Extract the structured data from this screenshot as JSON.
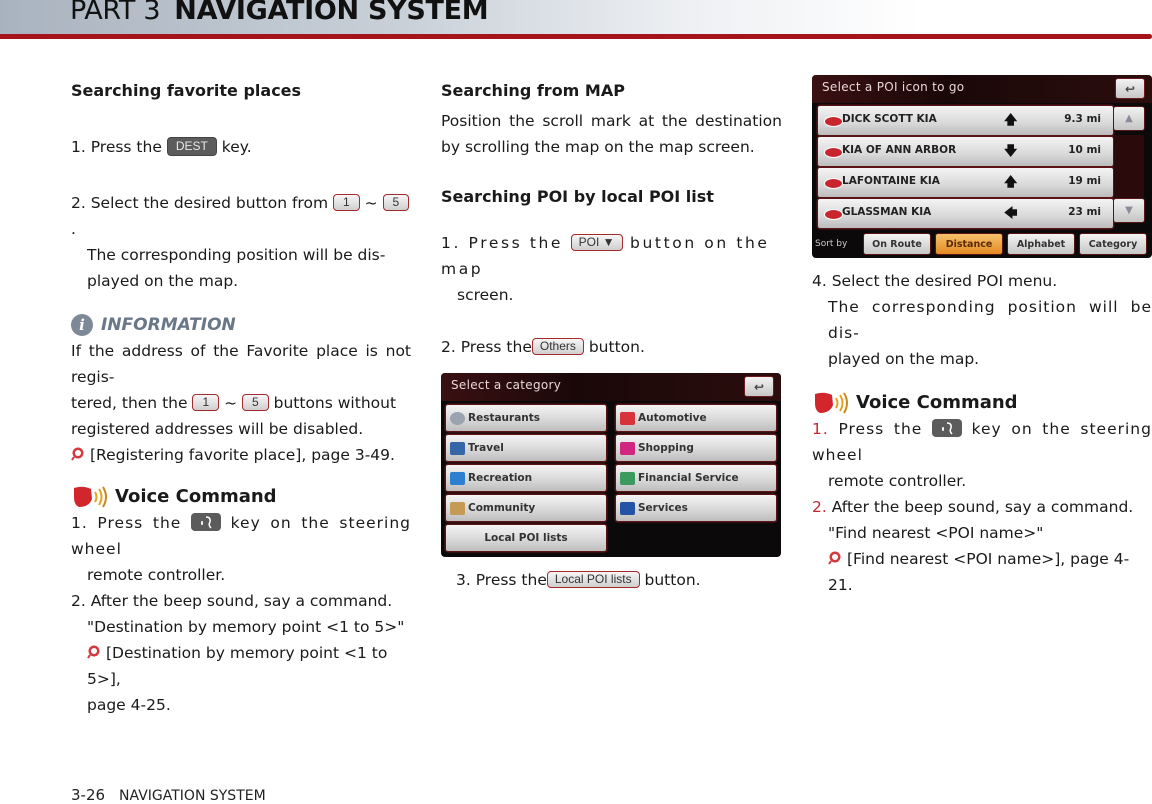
{
  "header": {
    "part": "PART 3",
    "title": "NAVIGATION SYSTEM"
  },
  "col1": {
    "heading": "Searching favorite places",
    "step1": {
      "pre": "1. Press the",
      "key": "DEST",
      "post": "key."
    },
    "step2": {
      "pre": "2. Select the desired button from",
      "key_a": "1",
      "tilde": "~",
      "key_b": "5",
      "post": ".",
      "line2": "The corresponding position will be dis-",
      "line3": "played on the map."
    },
    "info": {
      "title": "INFORMATION",
      "icon": "i",
      "line1": "If the address of the Favorite place is not regis-",
      "line2_pre": "tered, then the",
      "key_a": "1",
      "tilde": "~",
      "key_b": "5",
      "line2_post": "buttons  without",
      "line3": "registered addresses will be disabled.",
      "ref": "[Registering favorite place], page 3-49."
    },
    "voice": {
      "title": "Voice Command",
      "s1_pre": "1. Press the",
      "s1_post": "key on the steering wheel",
      "s1_line2": "remote controller.",
      "s2": "2. After the beep sound, say a command.",
      "s2_quote": "\"Destination by memory point <1 to 5>\"",
      "s2_ref": "[Destination by memory point <1 to 5>],",
      "s2_ref2": "page 4-25."
    }
  },
  "col2": {
    "heading_map": "Searching from MAP",
    "map_text": "Position the scroll mark at the destination by scrolling the map on the map screen.",
    "heading_poi": "Searching POI by local POI list",
    "step1": {
      "pre": "1. Press the",
      "key": "POI ▼",
      "post": "button on the map",
      "line2": "screen."
    },
    "step2": {
      "pre": "2. Press the",
      "key": "Others",
      "post": "button."
    },
    "screen": {
      "title": "Select a category",
      "back": "↩",
      "categories": [
        {
          "label": "Restaurants",
          "color": "#9aa3b0"
        },
        {
          "label": "Automotive",
          "color": "#d8323a"
        },
        {
          "label": "Travel",
          "color": "#3566a8"
        },
        {
          "label": "Shopping",
          "color": "#d1267f"
        },
        {
          "label": "Recreation",
          "color": "#2d7fd0"
        },
        {
          "label": "Financial Service",
          "color": "#3c9a5f"
        },
        {
          "label": "Community",
          "color": "#c49a55"
        },
        {
          "label": "Services",
          "color": "#2452a4"
        }
      ],
      "local_btn": "Local POI lists"
    },
    "step3": {
      "pre": "3. Press the",
      "key": "Local POI lists",
      "post": "button."
    }
  },
  "col3": {
    "screen": {
      "title": "Select a POI icon to go",
      "back": "↩",
      "rows": [
        {
          "name": "DICK SCOTT KIA",
          "dir": "🡅",
          "dist": "9.3 mi"
        },
        {
          "name": "KIA OF ANN ARBOR",
          "dir": "🡇",
          "dist": "10 mi"
        },
        {
          "name": "LAFONTAINE KIA",
          "dir": "🡅",
          "dist": "19 mi"
        },
        {
          "name": "GLASSMAN KIA",
          "dir": "🡄",
          "dist": "23 mi"
        }
      ],
      "scroll_up": "▲",
      "scroll_down": "▼",
      "sort_label": "Sort by",
      "sort": [
        {
          "label": "On Route",
          "active": false
        },
        {
          "label": "Distance",
          "active": true
        },
        {
          "label": "Alphabet",
          "active": false
        },
        {
          "label": "Category",
          "active": false
        }
      ]
    },
    "step4": {
      "line1": "4. Select the desired POI menu.",
      "line2": "The corresponding position will be dis-",
      "line3": "played on the map."
    },
    "voice": {
      "title": "Voice Command",
      "s1_num": "1.",
      "s1_pre": "Press the",
      "s1_post": "key on the steering wheel",
      "s1_line2": "remote controller.",
      "s2_num": "2.",
      "s2": "After the beep sound, say a command.",
      "s2_quote": "\"Find nearest <POI name>\"",
      "s2_ref": "[Find nearest <POI name>], page 4-21."
    }
  },
  "footer": {
    "page": "3-26",
    "section": "NAVIGATION SYSTEM"
  },
  "colors": {
    "accent_red": "#a5141b",
    "info_gray": "#6a7789",
    "active_sort": "#e48a22"
  }
}
